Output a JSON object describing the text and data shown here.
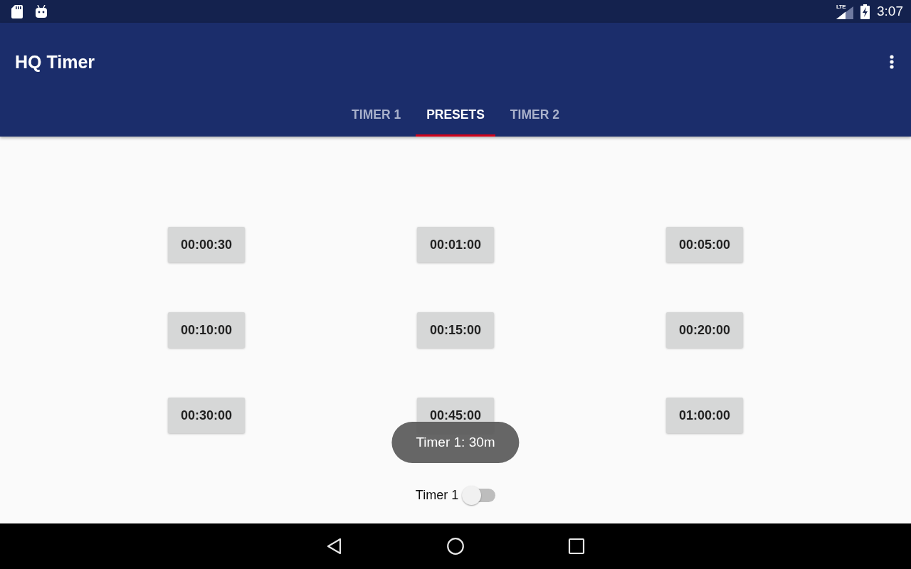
{
  "status_bar": {
    "network": "LTE",
    "time": "3:07"
  },
  "app_bar": {
    "title": "HQ Timer"
  },
  "tabs": [
    {
      "label": "TIMER 1",
      "selected": false
    },
    {
      "label": "PRESETS",
      "selected": true
    },
    {
      "label": "TIMER 2",
      "selected": false
    }
  ],
  "presets": [
    "00:00:30",
    "00:01:00",
    "00:05:00",
    "00:10:00",
    "00:15:00",
    "00:20:00",
    "00:30:00",
    "00:45:00",
    "01:00:00"
  ],
  "toast": {
    "text": "Timer 1: 30m"
  },
  "timer_switch": {
    "label": "Timer 1",
    "on": false
  }
}
